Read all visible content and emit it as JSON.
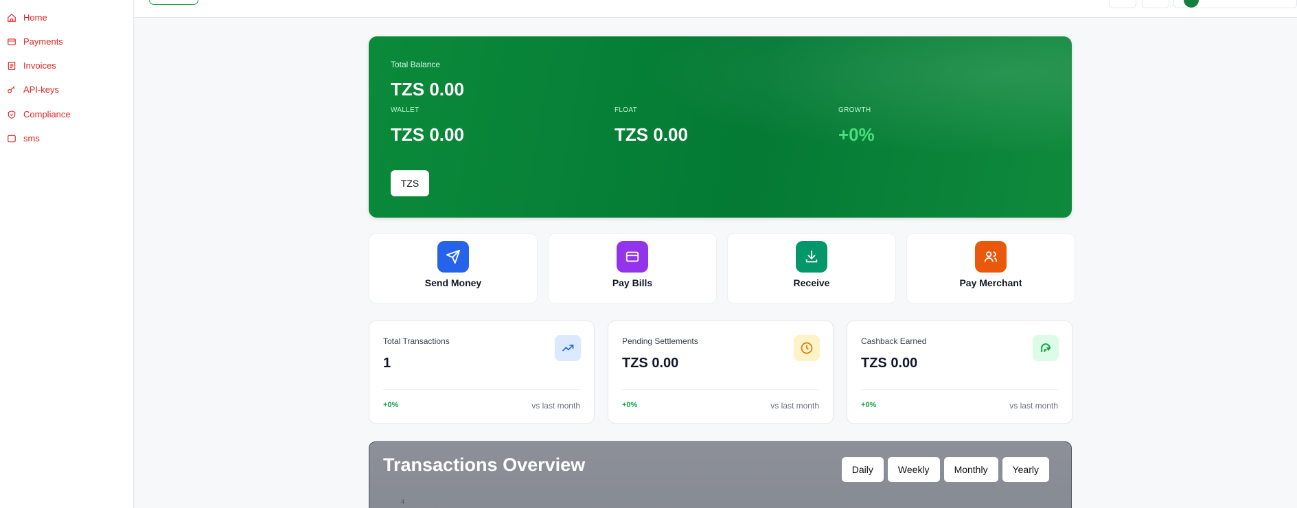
{
  "sidebar": {
    "items": [
      {
        "label": "Home",
        "icon": "home-icon"
      },
      {
        "label": "Payments",
        "icon": "card-icon"
      },
      {
        "label": "Invoices",
        "icon": "invoice-icon"
      },
      {
        "label": "API-keys",
        "icon": "key-icon"
      },
      {
        "label": "Compliance",
        "icon": "shield-icon"
      },
      {
        "label": "sms",
        "icon": "message-icon"
      }
    ]
  },
  "balance": {
    "total_label": "Total Balance",
    "total_value": "TZS 0.00",
    "wallet_label": "WALLET",
    "wallet_value": "TZS 0.00",
    "float_label": "FLOAT",
    "float_value": "TZS 0.00",
    "growth_label": "GROWTH",
    "growth_value": "+0%",
    "currency": "TZS"
  },
  "quick_actions": [
    {
      "label": "Send Money",
      "icon": "send-icon",
      "color": "#2563eb"
    },
    {
      "label": "Pay Bills",
      "icon": "card-icon",
      "color": "#9333ea"
    },
    {
      "label": "Receive",
      "icon": "download-icon",
      "color": "#059669"
    },
    {
      "label": "Pay Merchant",
      "icon": "users-icon",
      "color": "#ea580c"
    }
  ],
  "stats": [
    {
      "title": "Total Transactions",
      "value": "1",
      "change": "+0%",
      "note": "vs last month",
      "icon": "trending-up-icon",
      "icon_bg": "#dbeafe",
      "icon_color": "#2563eb"
    },
    {
      "title": "Pending Settlements",
      "value": "TZS 0.00",
      "change": "+0%",
      "note": "vs last month",
      "icon": "clock-icon",
      "icon_bg": "#fef3c7",
      "icon_color": "#d97706"
    },
    {
      "title": "Cashback Earned",
      "value": "TZS 0.00",
      "change": "+0%",
      "note": "vs last month",
      "icon": "refresh-icon",
      "icon_bg": "#dcfce7",
      "icon_color": "#16a34a"
    }
  ],
  "overview": {
    "title": "Transactions Overview",
    "tabs": [
      "Daily",
      "Weekly",
      "Monthly",
      "Yearly"
    ],
    "axis_tick": "4"
  }
}
